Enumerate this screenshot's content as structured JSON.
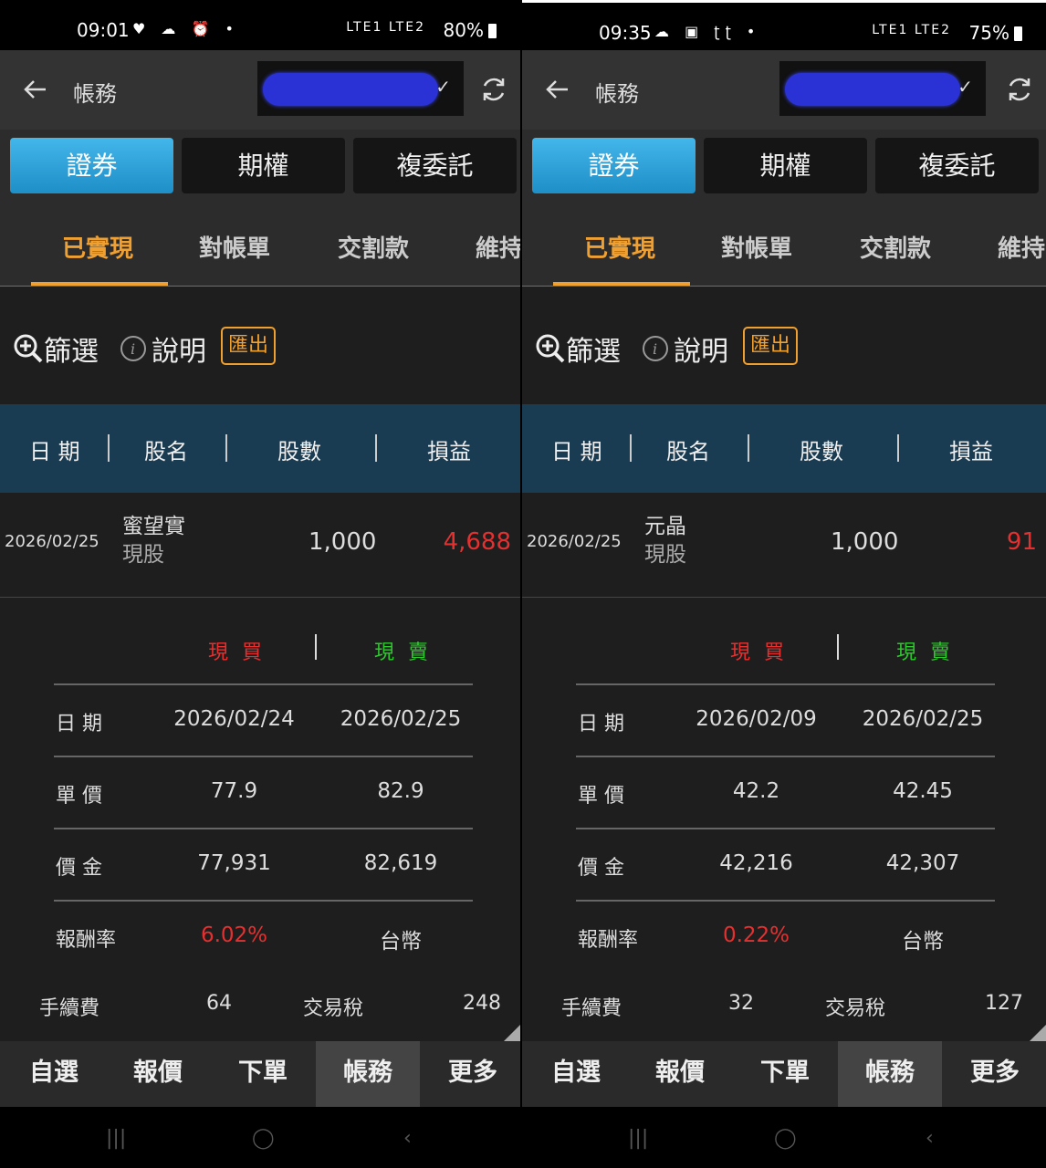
{
  "panels": [
    {
      "status": {
        "time": "09:01",
        "sys_icons": "♥ ☁ ⏰ •",
        "net": "LTE1 LTE2",
        "battery": "80%"
      },
      "title": "帳務",
      "segments": [
        "證券",
        "期權",
        "複委託"
      ],
      "tabs": [
        "已實現",
        "對帳單",
        "交割款",
        "維持"
      ],
      "tools": {
        "filter": "篩選",
        "help": "說明",
        "export": "匯出"
      },
      "columns": [
        "日 期",
        "股名",
        "股數",
        "損益"
      ],
      "row": {
        "date": "2026/02/25",
        "name": "蜜望實",
        "type": "現股",
        "qty": "1,000",
        "pnl": "4,688"
      },
      "detail": {
        "buy": "現 買",
        "sell": "現 賣",
        "rows": [
          {
            "label": "日 期",
            "buy": "2026/02/24",
            "sell": "2026/02/25"
          },
          {
            "label": "單 價",
            "buy": "77.9",
            "sell": "82.9"
          },
          {
            "label": "價 金",
            "buy": "77,931",
            "sell": "82,619"
          },
          {
            "label": "報酬率",
            "buy": "6.02%",
            "sell": "台幣"
          }
        ],
        "fee_label": "手續費",
        "fee": "64",
        "tax_label": "交易稅",
        "tax": "248"
      },
      "nav": [
        "自選",
        "報價",
        "下單",
        "帳務",
        "更多"
      ],
      "sysnav": [
        "|||",
        "◯",
        "‹"
      ]
    },
    {
      "status": {
        "time": "09:35",
        "sys_icons": "☁ ▣ ʈʈ •",
        "net": "LTE1 LTE2",
        "battery": "75%"
      },
      "title": "帳務",
      "segments": [
        "證券",
        "期權",
        "複委託"
      ],
      "tabs": [
        "已實現",
        "對帳單",
        "交割款",
        "維持"
      ],
      "tools": {
        "filter": "篩選",
        "help": "說明",
        "export": "匯出"
      },
      "columns": [
        "日 期",
        "股名",
        "股數",
        "損益"
      ],
      "row": {
        "date": "2026/02/25",
        "name": "元晶",
        "type": "現股",
        "qty": "1,000",
        "pnl": "91"
      },
      "detail": {
        "buy": "現 買",
        "sell": "現 賣",
        "rows": [
          {
            "label": "日 期",
            "buy": "2026/02/09",
            "sell": "2026/02/25"
          },
          {
            "label": "單 價",
            "buy": "42.2",
            "sell": "42.45"
          },
          {
            "label": "價 金",
            "buy": "42,216",
            "sell": "42,307"
          },
          {
            "label": "報酬率",
            "buy": "0.22%",
            "sell": "台幣"
          }
        ],
        "fee_label": "手續費",
        "fee": "32",
        "tax_label": "交易稅",
        "tax": "127"
      },
      "nav": [
        "自選",
        "報價",
        "下單",
        "帳務",
        "更多"
      ],
      "sysnav": [
        "|||",
        "◯",
        "‹"
      ]
    }
  ],
  "colors": {
    "accent": "#f0a030",
    "profit": "#e53030",
    "sell": "#2ec82e",
    "header": "#1a3c52",
    "segment_active": "#2aa0da"
  }
}
